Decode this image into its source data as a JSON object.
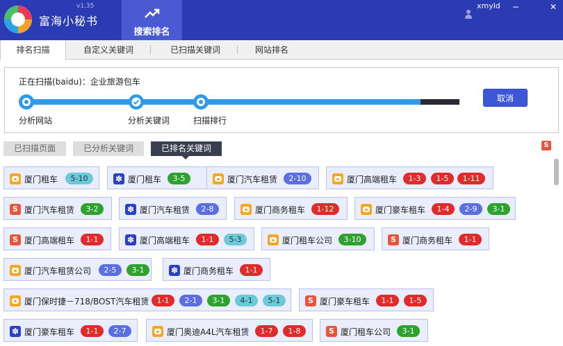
{
  "app": {
    "name": "富海小秘书",
    "version": "v1.35",
    "main_tab": "搜索排名",
    "user": "xmyld",
    "window_minimize": "−",
    "window_close": "✕"
  },
  "subtabs": [
    "排名扫描",
    "自定义关键词",
    "已扫描关键词",
    "网站排名"
  ],
  "progress": {
    "status": "正在扫描(baidu)：企业旅游包车",
    "steps": [
      "分析网站",
      "分析关键词",
      "扫描排行"
    ],
    "filled_fraction": 0.91,
    "cancel_label": "取消"
  },
  "filter_tabs": [
    "已扫描页面",
    "已分析关键词",
    "已排名关键词"
  ],
  "cards": [
    {
      "engine": "bing",
      "keyword": "厦门租车",
      "ranks": [
        {
          "t": "5-10",
          "c": "light"
        }
      ]
    },
    {
      "engine": "baidu",
      "keyword": "厦门租车",
      "ranks": [
        {
          "t": "3-5",
          "c": "green"
        }
      ]
    },
    {
      "engine": "bing",
      "keyword": "厦门汽车租赁",
      "ranks": [
        {
          "t": "2-10",
          "c": "blue"
        }
      ]
    },
    {
      "engine": "bing",
      "keyword": "厦门高端租车",
      "ranks": [
        {
          "t": "1-3",
          "c": "red"
        },
        {
          "t": "1-5",
          "c": "red"
        },
        {
          "t": "1-11",
          "c": "red"
        }
      ]
    },
    {
      "engine": "sogou",
      "keyword": "厦门汽车租赁",
      "ranks": [
        {
          "t": "3-2",
          "c": "green"
        }
      ]
    },
    {
      "engine": "baidu",
      "keyword": "厦门汽车租赁",
      "ranks": [
        {
          "t": "2-8",
          "c": "blue"
        }
      ]
    },
    {
      "engine": "bing",
      "keyword": "厦门商务租车",
      "ranks": [
        {
          "t": "1-12",
          "c": "red"
        }
      ]
    },
    {
      "engine": "bing",
      "keyword": "厦门豪车租车",
      "ranks": [
        {
          "t": "1-4",
          "c": "red"
        },
        {
          "t": "2-9",
          "c": "blue"
        },
        {
          "t": "3-1",
          "c": "green"
        }
      ]
    },
    {
      "engine": "sogou",
      "keyword": "厦门高端租车",
      "ranks": [
        {
          "t": "1-1",
          "c": "red"
        }
      ]
    },
    {
      "engine": "baidu",
      "keyword": "厦门高端租车",
      "ranks": [
        {
          "t": "1-1",
          "c": "red"
        },
        {
          "t": "5-3",
          "c": "light"
        }
      ]
    },
    {
      "engine": "bing",
      "keyword": "厦门租车公司",
      "ranks": [
        {
          "t": "3-10",
          "c": "green"
        }
      ]
    },
    {
      "engine": "sogou",
      "keyword": "厦门商务租车",
      "ranks": [
        {
          "t": "1-1",
          "c": "red"
        }
      ]
    },
    {
      "engine": "bing",
      "keyword": "厦门汽车租赁公司",
      "ranks": [
        {
          "t": "2-5",
          "c": "blue"
        },
        {
          "t": "3-1",
          "c": "green"
        }
      ]
    },
    {
      "engine": "baidu",
      "keyword": "厦门商务租车",
      "ranks": [
        {
          "t": "1-1",
          "c": "red"
        }
      ]
    },
    {
      "engine": "bing",
      "keyword": "厦门保时捷－718/BOST汽车租赁",
      "ranks": [
        {
          "t": "1-1",
          "c": "red"
        },
        {
          "t": "2-1",
          "c": "blue"
        },
        {
          "t": "3-1",
          "c": "green"
        },
        {
          "t": "4-1",
          "c": "light"
        },
        {
          "t": "5-1",
          "c": "light"
        }
      ]
    },
    {
      "engine": "sogou",
      "keyword": "厦门豪车租车",
      "ranks": [
        {
          "t": "1-1",
          "c": "red"
        },
        {
          "t": "1-5",
          "c": "red"
        }
      ]
    },
    {
      "engine": "baidu",
      "keyword": "厦门豪车租车",
      "ranks": [
        {
          "t": "1-1",
          "c": "red"
        },
        {
          "t": "2-7",
          "c": "blue"
        }
      ]
    },
    {
      "engine": "bing",
      "keyword": "厦门奥迪A4L汽车租赁",
      "ranks": [
        {
          "t": "1-7",
          "c": "red"
        },
        {
          "t": "1-8",
          "c": "red"
        }
      ]
    },
    {
      "engine": "sogou",
      "keyword": "厦门租车公司",
      "ranks": [
        {
          "t": "3-1",
          "c": "green"
        }
      ]
    }
  ]
}
